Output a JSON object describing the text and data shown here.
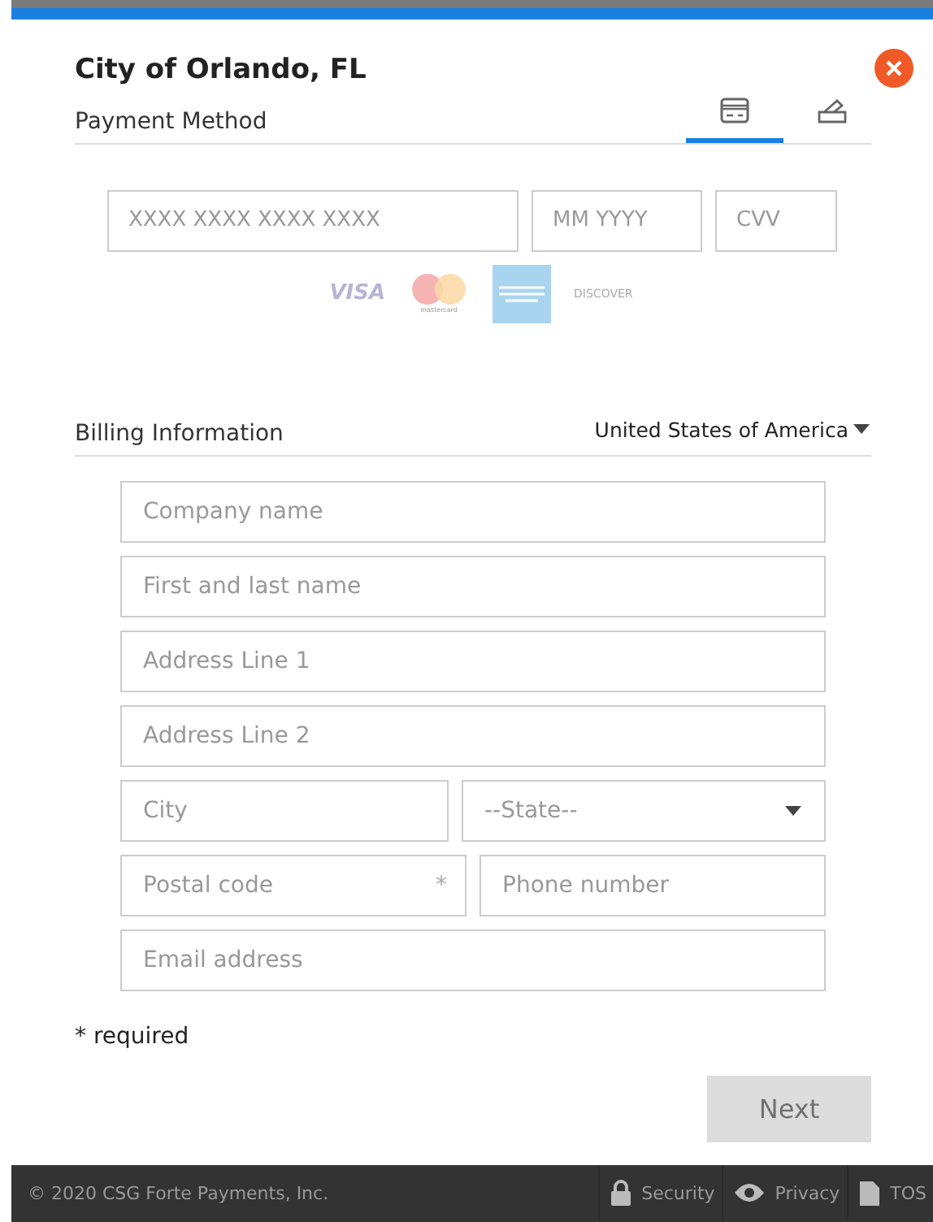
{
  "header": {
    "title": "City of Orlando, FL"
  },
  "payment": {
    "heading": "Payment Method",
    "tabs": [
      {
        "kind": "card",
        "selected": true
      },
      {
        "kind": "check",
        "selected": false
      }
    ],
    "fields": [
      {
        "placeholder": "XXXX XXXX XXXX XXXX"
      },
      {
        "placeholder": "MM YYYY"
      },
      {
        "placeholder": "CVV"
      }
    ],
    "card_brands": [
      {
        "kind": "visa",
        "label": "VISA"
      },
      {
        "kind": "mastercard",
        "label": "mastercard"
      },
      {
        "kind": "amex"
      },
      {
        "kind": "discover",
        "label": "DISCOVER"
      }
    ]
  },
  "billing": {
    "heading": "Billing Information",
    "country": "United States of America",
    "rows": [
      [
        {
          "kind": "input",
          "placeholder": "Company name"
        }
      ],
      [
        {
          "kind": "input",
          "placeholder": "First and last name"
        }
      ],
      [
        {
          "kind": "input",
          "placeholder": "Address Line 1"
        }
      ],
      [
        {
          "kind": "input",
          "placeholder": "Address Line 2"
        }
      ],
      [
        {
          "kind": "input",
          "placeholder": "City"
        },
        {
          "kind": "select",
          "value": "--State--"
        }
      ],
      [
        {
          "kind": "input",
          "placeholder": "Postal code",
          "required_mark": "*"
        },
        {
          "kind": "input",
          "placeholder": "Phone number"
        }
      ],
      [
        {
          "kind": "input",
          "placeholder": "Email address"
        }
      ]
    ],
    "required_note": "* required"
  },
  "next_button": {
    "label": "Next",
    "disabled": true
  },
  "footer": {
    "copyright": "© 2020 CSG Forte Payments, Inc.",
    "links": [
      {
        "kind": "security",
        "label": "Security"
      },
      {
        "kind": "privacy",
        "label": "Privacy"
      },
      {
        "kind": "tos",
        "label": "TOS"
      }
    ]
  }
}
